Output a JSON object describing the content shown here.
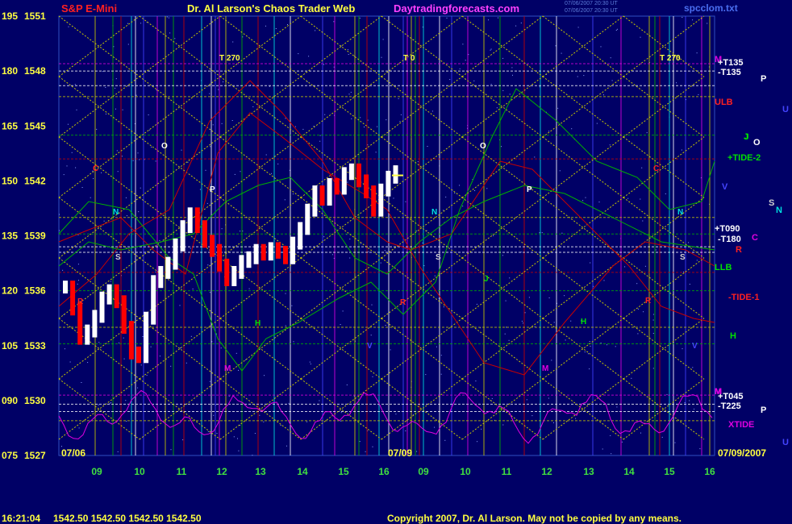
{
  "header": {
    "instrument": "S&P E-Mini",
    "title": "Dr. Al Larson's Chaos Trader Web",
    "site": "Daytradingforecasts.com",
    "stamp1": "07/06/2007 20:30 UT",
    "stamp2": "07/06/2007 20:30 UT",
    "file": "spcclom.txt"
  },
  "footer": {
    "time": "16:21:04",
    "quote": "1542.50  1542.50  1542.50  1542.50",
    "copyright": "Copyright 2007, Dr. Al Larson. May not be copied by any means."
  },
  "colors": {
    "background": "#000066",
    "grid_yellow": "#c8c800",
    "grid_green": "#00b000",
    "red": "#c80000",
    "magenta": "#e000e0",
    "cyan": "#00e0e0",
    "price_up": "#ffffff",
    "price_down": "#ff0000"
  },
  "chart_data": {
    "type": "candlestick",
    "title": "S&P E-Mini",
    "y_left_labels": [
      "195",
      "180",
      "165",
      "150",
      "135",
      "120",
      "105",
      "090",
      "075"
    ],
    "y_price_labels": [
      "1551",
      "1548",
      "1545",
      "1542",
      "1539",
      "1536",
      "1533",
      "1530",
      "1527"
    ],
    "ylim": [
      1527,
      1551
    ],
    "date_labels": [
      "07/06",
      "07/09",
      "07/09/2007"
    ],
    "x_hours": [
      "09",
      "10",
      "11",
      "12",
      "13",
      "14",
      "15",
      "16",
      "09",
      "10",
      "11",
      "12",
      "13",
      "14",
      "15",
      "16"
    ],
    "right_labels": [
      {
        "text": "M",
        "color": "#e000e0"
      },
      {
        "text": "+T135",
        "color": "#ffffff"
      },
      {
        "text": "-T135",
        "color": "#ffffff"
      },
      {
        "text": "P",
        "color": "#ffffff"
      },
      {
        "text": "U",
        "color": "#4444ff"
      },
      {
        "text": "ULB",
        "color": "#ff2020"
      },
      {
        "text": "J",
        "color": "#00e000"
      },
      {
        "text": "O",
        "color": "#ffffff"
      },
      {
        "text": "+TIDE-2",
        "color": "#00e000"
      },
      {
        "text": "V",
        "color": "#4444ff"
      },
      {
        "text": "S",
        "color": "#d0d0d0"
      },
      {
        "text": "N",
        "color": "#00e0e0"
      },
      {
        "text": "+T090",
        "color": "#ffffff"
      },
      {
        "text": "-T180",
        "color": "#ffffff"
      },
      {
        "text": "C",
        "color": "#e000e0"
      },
      {
        "text": "R",
        "color": "#ff2020"
      },
      {
        "text": "LLB",
        "color": "#00e000"
      },
      {
        "text": "-TIDE-1",
        "color": "#ff2020"
      },
      {
        "text": "H",
        "color": "#00e000"
      },
      {
        "text": "M",
        "color": "#e000e0"
      },
      {
        "text": "+T045",
        "color": "#ffffff"
      },
      {
        "text": "-T225",
        "color": "#ffffff"
      },
      {
        "text": "P",
        "color": "#ffffff"
      },
      {
        "text": "XTIDE",
        "color": "#e000e0"
      },
      {
        "text": "U",
        "color": "#4444ff"
      }
    ],
    "top_markers": [
      "T 270",
      "T 0",
      "T 270"
    ],
    "planet_labels": [
      {
        "text": "C",
        "color": "#ff2020"
      },
      {
        "text": "O",
        "color": "#ffffff"
      },
      {
        "text": "P",
        "color": "#ffffff"
      },
      {
        "text": "N",
        "color": "#00e0e0"
      },
      {
        "text": "S",
        "color": "#d0d0d0"
      },
      {
        "text": "R",
        "color": "#ff2020"
      },
      {
        "text": "H",
        "color": "#00e000"
      },
      {
        "text": "M",
        "color": "#e000e0"
      },
      {
        "text": "V",
        "color": "#4444ff"
      },
      {
        "text": "J",
        "color": "#00e000"
      },
      {
        "text": "O",
        "color": "#ffffff"
      },
      {
        "text": "P",
        "color": "#ffffff"
      },
      {
        "text": "N",
        "color": "#00e0e0"
      },
      {
        "text": "S",
        "color": "#d0d0d0"
      },
      {
        "text": "R",
        "color": "#ff2020"
      },
      {
        "text": "H",
        "color": "#00e000"
      },
      {
        "text": "M",
        "color": "#e000e0"
      },
      {
        "text": "C",
        "color": "#ff2020"
      },
      {
        "text": "R",
        "color": "#ff2020"
      },
      {
        "text": "N",
        "color": "#00e0e0"
      },
      {
        "text": "S",
        "color": "#d0d0d0"
      },
      {
        "text": "V",
        "color": "#4444ff"
      },
      {
        "text": "J",
        "color": "#00e000"
      },
      {
        "text": "M",
        "color": "#e000e0"
      }
    ],
    "price_series": [
      1536.2,
      1535.0,
      1533.4,
      1533.8,
      1534.6,
      1535.6,
      1536.0,
      1535.4,
      1534.0,
      1532.6,
      1532.4,
      1534.5,
      1536.5,
      1537.0,
      1537.5,
      1538.5,
      1539.5,
      1540.2,
      1539.5,
      1538.7,
      1538.2,
      1537.4,
      1536.6,
      1537.0,
      1537.6,
      1537.8,
      1538.2,
      1538.0,
      1538.3,
      1538.1,
      1537.8,
      1538.6,
      1539.4,
      1540.4,
      1541.4,
      1541.0,
      1541.8,
      1541.6,
      1542.4,
      1542.6,
      1542.0,
      1541.4,
      1540.4,
      1541.5,
      1542.2,
      1542.5
    ]
  }
}
